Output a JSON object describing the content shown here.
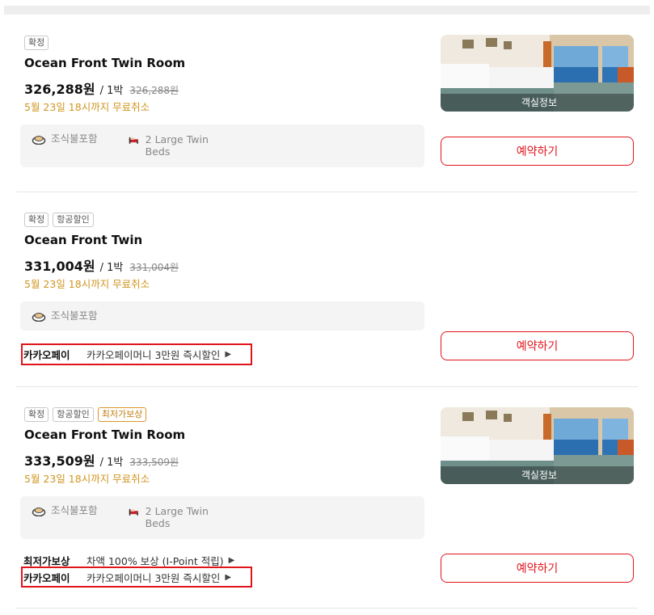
{
  "rooms": [
    {
      "badges": [
        "확정"
      ],
      "name": "Ocean Front Twin Room",
      "price": "326,288원",
      "per_night": "/ 1박",
      "original_price": "326,288원",
      "cancel": "5월 23일 18시까지 무료취소",
      "amenities": {
        "breakfast": "조식불포함",
        "beds": "2 Large Twin Beds"
      },
      "image_label": "객실정보",
      "book_label": "예약하기"
    },
    {
      "badges": [
        "확정",
        "항공할인"
      ],
      "name": "Ocean Front Twin",
      "price": "331,004원",
      "per_night": "/ 1박",
      "original_price": "331,004원",
      "cancel": "5월 23일 18시까지 무료취소",
      "amenities": {
        "breakfast": "조식불포함"
      },
      "promos": [
        {
          "label": "카카오페이",
          "desc": "카카오페이머니 3만원 즉시할인",
          "arrow": "▶"
        }
      ],
      "book_label": "예약하기"
    },
    {
      "badges": [
        "확정",
        "항공할인",
        "최저가보상"
      ],
      "name": "Ocean Front Twin Room",
      "price": "333,509원",
      "per_night": "/ 1박",
      "original_price": "333,509원",
      "cancel": "5월 23일 18시까지 무료취소",
      "amenities": {
        "breakfast": "조식불포함",
        "beds": "2 Large Twin Beds"
      },
      "image_label": "객실정보",
      "promos": [
        {
          "label": "최저가보상",
          "desc": "차액 100% 보상 (I-Point 적립)",
          "arrow": "▶"
        },
        {
          "label": "카카오페이",
          "desc": "카카오페이머니 3만원 즉시할인",
          "arrow": "▶"
        }
      ],
      "book_label": "예약하기"
    }
  ],
  "colors": {
    "accent": "#e2141b",
    "cancel": "#d0951e",
    "badge_orange": "#c27d12"
  }
}
